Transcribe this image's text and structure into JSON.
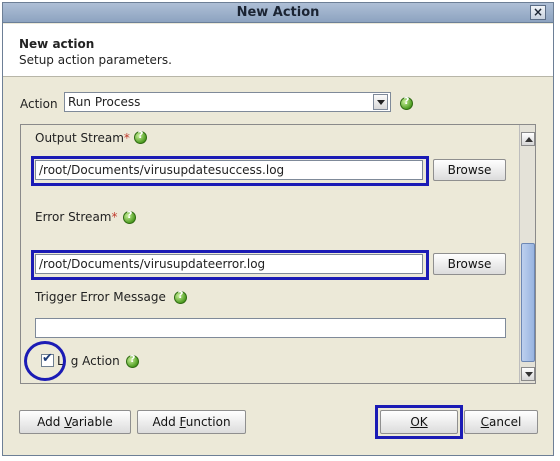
{
  "dialog": {
    "title": "New Action",
    "close_glyph": "×"
  },
  "header": {
    "title": "New action",
    "subtitle": "Setup action parameters."
  },
  "action": {
    "label": "Action",
    "selected": "Run Process"
  },
  "fields": {
    "output_stream": {
      "label": "Output Stream",
      "required_mark": "*",
      "value": "/root/Documents/virusupdatesuccess.log",
      "browse_label": "Browse"
    },
    "error_stream": {
      "label": "Error Stream",
      "required_mark": "*",
      "value": "/root/Documents/virusupdateerror.log",
      "browse_label": "Browse"
    },
    "trigger_error_message": {
      "label": "Trigger Error Message",
      "value": ""
    },
    "log_action": {
      "label_pre": "L",
      "label_post": "g Action",
      "checked": true
    }
  },
  "footer": {
    "add_variable": {
      "pre": "Add ",
      "mnemonic": "V",
      "post": "ariable"
    },
    "add_function": {
      "pre": "Add ",
      "mnemonic": "F",
      "post": "unction"
    },
    "ok": {
      "mnemonic": "O",
      "post": "K"
    },
    "cancel": {
      "mnemonic": "C",
      "post": "ancel"
    }
  },
  "icons": {
    "help": "help-icon",
    "check": "✔"
  },
  "colors": {
    "highlight": "#1b1bb5",
    "required": "#c0392b",
    "help_icon": "#4f9e22",
    "scroll_thumb": "#98b4e0"
  }
}
